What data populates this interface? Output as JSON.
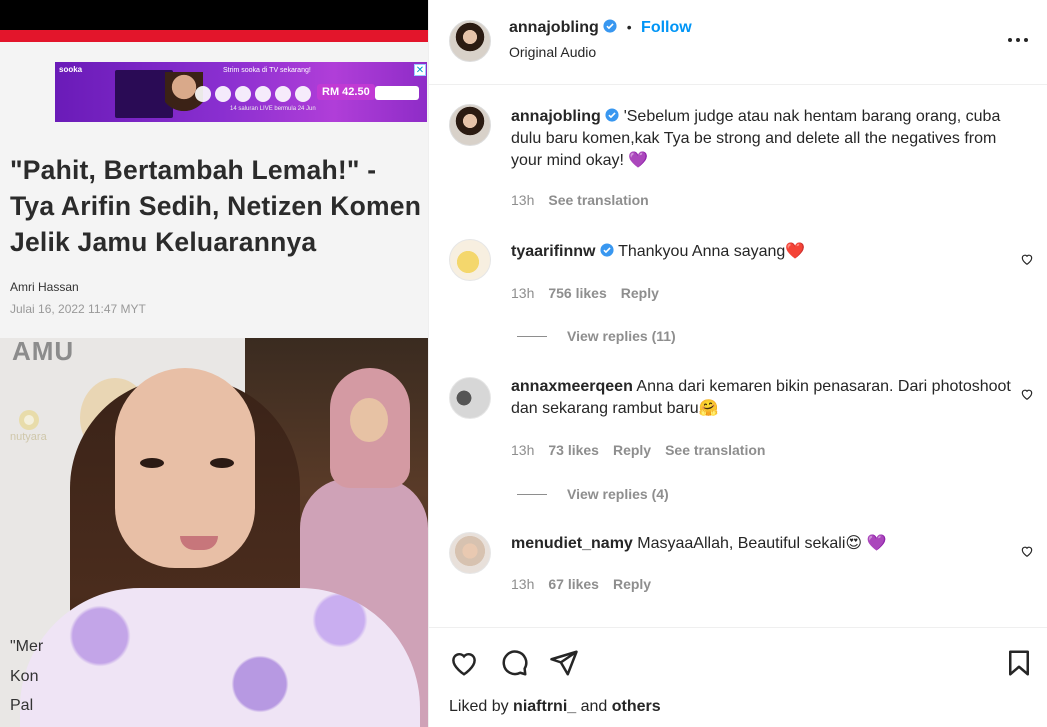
{
  "media": {
    "ad": {
      "logo": "sooka",
      "headline": "Strim sooka di TV sekarang!",
      "price": "RM 42.50",
      "sub": "14 saluran LIVE bermula 24 Jun"
    },
    "headline": "\"Pahit, Bertambah Lemah!\" - Tya Arifin Sedih, Netizen Komen Jelik Jamu Keluarannya",
    "author": "Amri Hassan",
    "date": "Julai 16, 2022 11:47 MYT",
    "photo_text": "AMU",
    "brand_text": "nutyara",
    "cut_lines": [
      "\"Mer",
      "Kon",
      "Pal"
    ]
  },
  "post": {
    "username": "annajobling",
    "separator": "•",
    "follow_label": "Follow",
    "audio": "Original Audio"
  },
  "comments": [
    {
      "username": "annajobling",
      "text": "'Sebelum judge atau nak hentam barang orang, cuba dulu baru komen,kak Tya be strong and delete all the negatives from your mind okay! 💜",
      "time": "13h",
      "see_translation": "See translation"
    },
    {
      "username": "tyaarifinnw",
      "text": "Thankyou Anna sayang❤️",
      "time": "13h",
      "likes": "756 likes",
      "reply": "Reply",
      "view_replies": "View replies (11)"
    },
    {
      "username": "annaxmeerqeen",
      "text": "Anna dari kemaren bikin penasaran. Dari photoshoot dan sekarang rambut baru🤗",
      "time": "13h",
      "likes": "73 likes",
      "reply": "Reply",
      "see_translation": "See translation",
      "view_replies": "View replies (4)"
    },
    {
      "username": "menudiet_namy",
      "text": "MasyaaAllah, Beautiful sekali😍 💜",
      "time": "13h",
      "likes": "67 likes",
      "reply": "Reply"
    }
  ],
  "liked_by": {
    "prefix": "Liked by",
    "user": "niaftrni_",
    "mid": "and",
    "suffix": "others"
  },
  "colors": {
    "accent": "#0095f6",
    "verified": "#3897f0",
    "muted": "#8e8e8e",
    "brand_red": "#e3152b"
  }
}
